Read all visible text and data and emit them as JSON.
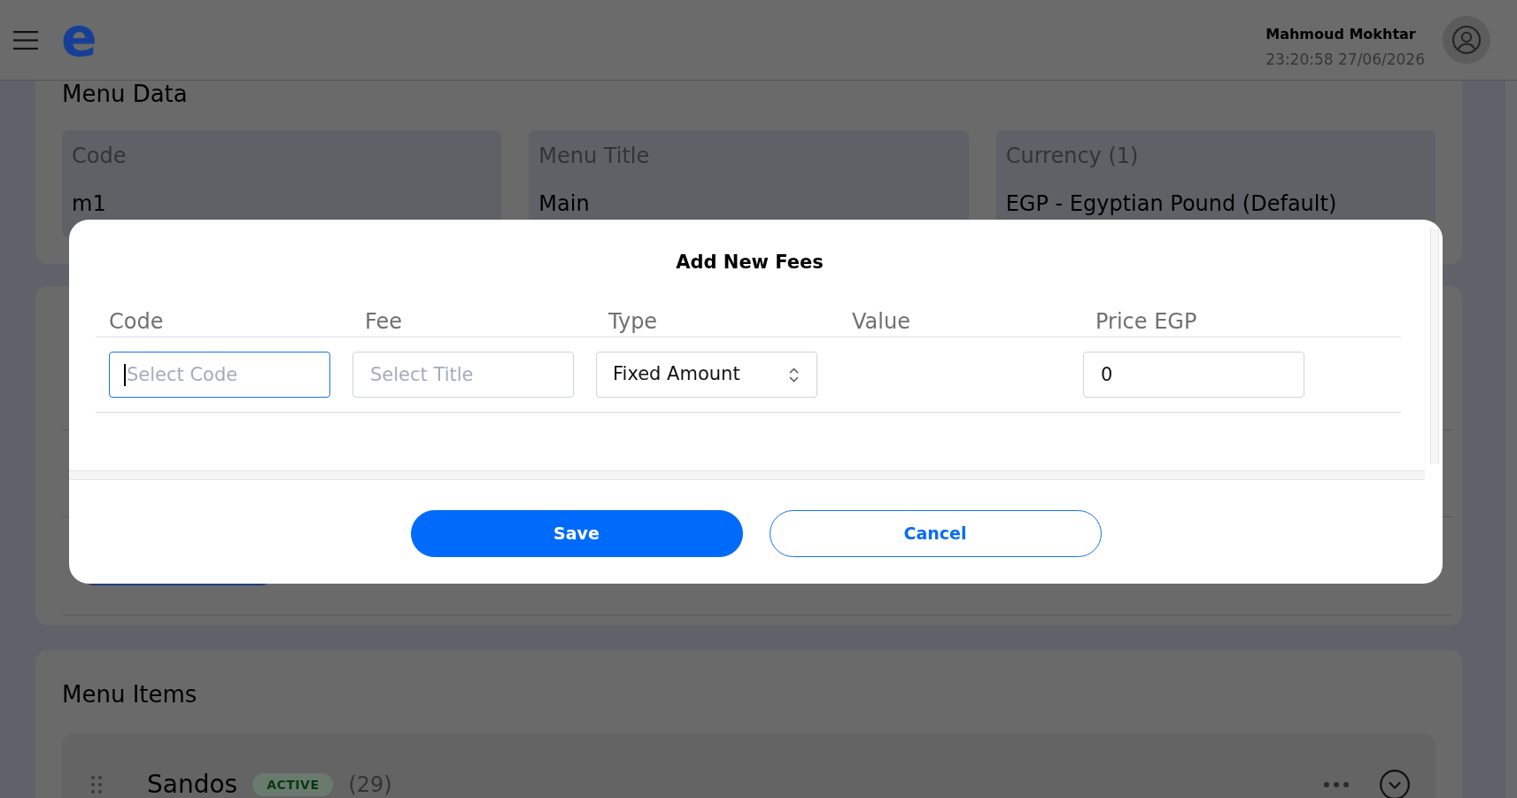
{
  "top_bar": {
    "logo": "e",
    "user": {
      "name": "Mahmoud Mokhtar",
      "datetime": "23:20:58 27/06/2026"
    }
  },
  "menu_data": {
    "title": "Menu Data",
    "fields": [
      {
        "label": "Code",
        "value": "m1"
      },
      {
        "label": "Menu Title",
        "value": "Main"
      },
      {
        "label": "Currency (1)",
        "value": "EGP - Egyptian Pound (Default)"
      }
    ]
  },
  "menu_items": {
    "title": "Menu Items",
    "items": [
      {
        "name": "Sandos",
        "status": "ACTIVE",
        "count": "(29)",
        "expanded": false
      }
    ]
  },
  "dialog": {
    "title": "Add New Fees",
    "columns": [
      "Code",
      "Fee",
      "Type",
      "Value",
      "Price EGP"
    ],
    "row": {
      "cells": [
        {
          "kind": "input",
          "placeholder": "Select Code",
          "focused": true
        },
        {
          "kind": "input",
          "placeholder": "Select Title",
          "focused": false
        },
        {
          "kind": "select",
          "value": "Fixed Amount"
        },
        {
          "kind": "empty"
        },
        {
          "kind": "input",
          "value": "0",
          "focused": false
        }
      ]
    },
    "buttons": [
      {
        "label": "Save",
        "kind": "primary"
      },
      {
        "label": "Cancel",
        "kind": "secondary"
      }
    ]
  }
}
